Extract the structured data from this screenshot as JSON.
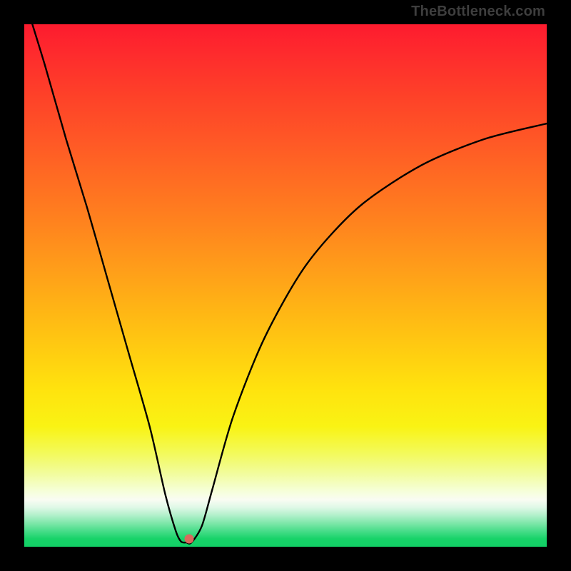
{
  "watermark": "TheBottleneck.com",
  "dot": {
    "x_pct": 31.5,
    "y_pct": 98.5
  },
  "colors": {
    "frame": "#000000",
    "curve": "#000000",
    "dot": "#d96a5e",
    "watermark": "#3e3e3e",
    "gradient_top": "#fd1b2e",
    "gradient_bottom": "#12d066"
  },
  "chart_data": {
    "type": "line",
    "title": "",
    "xlabel": "",
    "ylabel": "",
    "xlim": [
      0,
      100
    ],
    "ylim": [
      0,
      100
    ],
    "grid": false,
    "series": [
      {
        "name": "bottleneck-curve",
        "x": [
          0,
          4,
          8,
          12,
          16,
          20,
          24,
          27,
          29,
          30,
          31,
          32,
          34,
          36,
          40,
          46,
          54,
          64,
          76,
          88,
          100
        ],
        "values": [
          105,
          92,
          78,
          65,
          51,
          37,
          23,
          10,
          3,
          1,
          0.8,
          0.8,
          4,
          11,
          25,
          40,
          54,
          65,
          73,
          78,
          81
        ]
      }
    ],
    "annotations": [
      {
        "type": "point",
        "name": "minimum-marker",
        "x": 31.5,
        "y": 1.5
      }
    ]
  }
}
